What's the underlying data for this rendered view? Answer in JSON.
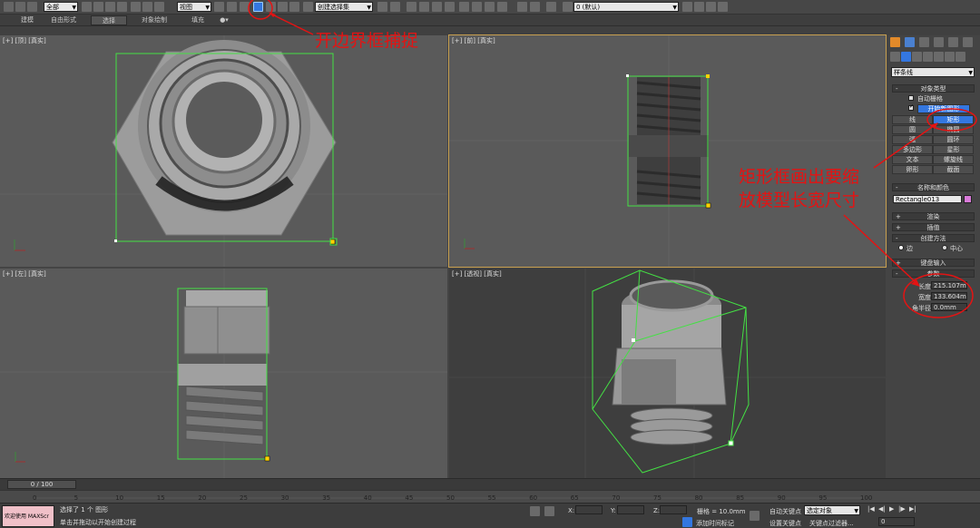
{
  "toolbar": {
    "selection_filter": "全部",
    "view_dropdown": "视图",
    "named_selection": "创建选择集",
    "layer_dropdown": "0 (默认)",
    "colors": {
      "accent": "#3477e0",
      "highlight": "#ffd200",
      "snap_red": "#e41313"
    }
  },
  "ribbon_tabs": [
    "建模",
    "自由形式",
    "选择",
    "对象绘制",
    "填充"
  ],
  "viewports": {
    "top": {
      "label": "[+] [顶] [真实]"
    },
    "front": {
      "label": "[+] [前] [真实]"
    },
    "left": {
      "label": "[+] [左] [真实]"
    },
    "perspective": {
      "label": "[+] [透视] [真实]"
    }
  },
  "command_panel": {
    "category_dropdown": "样条线",
    "object_type_title": "对象类型",
    "auto_grid": "自动栅格",
    "start_new_shape": "开始新图形",
    "shape_buttons": [
      "线",
      "矩形",
      "圆",
      "椭圆",
      "弧",
      "圆环",
      "多边形",
      "星形",
      "文本",
      "螺旋线",
      "卵形",
      "截面"
    ],
    "name_color_title": "名称和颜色",
    "object_name": "Rectangle013",
    "object_color": "#d97ad9",
    "rollouts_collapsed": [
      "渲染",
      "插值"
    ],
    "creation_method_title": "创建方法",
    "creation_options": [
      "边",
      "中心"
    ],
    "keyboard_entry": "键盘输入",
    "parameters_title": "参数",
    "params": [
      {
        "label": "长度:",
        "value": "215.107m"
      },
      {
        "label": "宽度:",
        "value": "133.604m"
      },
      {
        "label": "角半径:",
        "value": "0.0mm"
      }
    ]
  },
  "timeline": {
    "frame_display": "0 / 100",
    "ticks": [
      "0",
      "5",
      "10",
      "15",
      "20",
      "25",
      "30",
      "35",
      "40",
      "45",
      "50",
      "55",
      "60",
      "65",
      "70",
      "75",
      "80",
      "85",
      "90",
      "95",
      "100"
    ]
  },
  "status": {
    "welcome": "欢迎使用 MAXScr",
    "selected": "选择了 1 个 图形",
    "prompt": "单击并拖动以开始创建过程",
    "x_label": "X:",
    "y_label": "Y:",
    "z_label": "Z:",
    "grid": "栅格 = 10.0mm",
    "add_time_tag": "添加时间标记",
    "auto_key": "自动关键点",
    "selected_obj": "选定对象",
    "set_key": "设置关键点",
    "key_filters": "关键点过滤器...",
    "frame": "0"
  },
  "annotations": {
    "bbox_snap": "开边界框捕捉",
    "rect_instruction_line1": "矩形框画出要缩",
    "rect_instruction_line2": "放模型长宽尺寸"
  }
}
